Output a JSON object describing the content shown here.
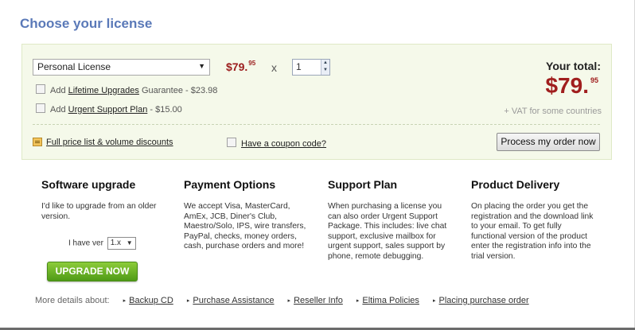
{
  "page_title": "Choose your license",
  "order": {
    "license_select": "Personal License",
    "price_main": "$79.",
    "price_cents": "95",
    "times": "x",
    "quantity": "1",
    "addons": [
      {
        "prefix": "Add ",
        "link": "Lifetime Upgrades",
        "suffix": " Guarantee - $23.98"
      },
      {
        "prefix": "Add ",
        "link": "Urgent Support Plan",
        "suffix": " - $15.00"
      }
    ],
    "total_label": "Your total:",
    "total_main": "$79.",
    "total_cents": "95",
    "vat_note": "+ VAT for some countries",
    "price_list_link": "Full price list & volume discounts",
    "coupon_link": "Have a coupon code?",
    "process_button": "Process my order now"
  },
  "columns": [
    {
      "title": "Software upgrade",
      "text": "I'd like to upgrade from an older version."
    },
    {
      "title": "Payment Options",
      "text": "We accept Visa, MasterCard, AmEx, JCB, Diner's Club, Maestro/Solo, IPS, wire transfers, PayPal, checks, money orders, cash, purchase orders and more!"
    },
    {
      "title": "Support Plan",
      "text": "When purchasing a license you can also order Urgent Support Package. This includes: live chat support, exclusive mailbox for urgent support, sales support by phone, remote debugging."
    },
    {
      "title": "Product Delivery",
      "text": "On placing the order you get the registration and the download link to your email. To get fully functional version of the product enter the registration info into the trial version."
    }
  ],
  "upgrade": {
    "version_label": "I have ver",
    "version_value": "1.x",
    "button": "UPGRADE NOW"
  },
  "more_details": {
    "label": "More details about:",
    "links": [
      "Backup CD",
      "Purchase Assistance",
      "Reseller Info",
      "Eltima Policies",
      "Placing purchase order"
    ]
  },
  "colors": {
    "title": "#5a79b8",
    "price": "#9b1c1c",
    "order_box_bg": "#f5f9ea",
    "upgrade_button": "#5fae1e"
  },
  "icons": [
    "chevron-down-icon",
    "spinner-arrows-icon",
    "checkbox-icon",
    "price-list-icon",
    "bullet-arrow-icon"
  ]
}
